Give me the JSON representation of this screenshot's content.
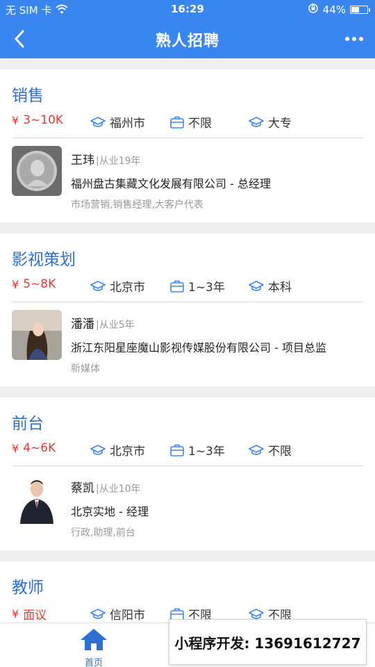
{
  "status_bar": {
    "carrier": "无 SIM 卡",
    "time": "16:29",
    "battery_percent": "44%",
    "battery_level": 0.44
  },
  "navbar": {
    "title": "熟人招聘",
    "back_icon": "chevron-left-icon",
    "more_icon": "more-dots-icon"
  },
  "jobs": [
    {
      "title": "销售",
      "salary": "3~10K",
      "city": "福州市",
      "experience": "不限",
      "education": "大专",
      "person": {
        "name": "王玮",
        "years": "|从业19年",
        "company": "福州盘古集藏文化发展有限公司 - 总经理",
        "tags": "市场营销,销售经理,大客户代表"
      }
    },
    {
      "title": "影视策划",
      "salary": "5~8K",
      "city": "北京市",
      "experience": "1~3年",
      "education": "本科",
      "person": {
        "name": "潘潘",
        "years": "|从业5年",
        "company": "浙江东阳星座魔山影视传媒股份有限公司 - 项目总监",
        "tags": "新媒体"
      }
    },
    {
      "title": "前台",
      "salary": "4~6K",
      "city": "北京市",
      "experience": "1~3年",
      "education": "不限",
      "person": {
        "name": "蔡凯",
        "years": "|从业10年",
        "company": "北京实地 - 经理",
        "tags": "行政,助理,前台"
      }
    },
    {
      "title": "教师",
      "salary": "面议",
      "city": "信阳市",
      "experience": "不限",
      "education": "不限"
    }
  ],
  "tabbar": {
    "home_label": "首页",
    "home_icon": "home-icon"
  },
  "dev_banner": {
    "text": "小程序开发: 13691612727"
  },
  "colors": {
    "brand_blue": "#3a86f0",
    "title_blue": "#2e6fd1",
    "salary_red": "#e53935"
  }
}
